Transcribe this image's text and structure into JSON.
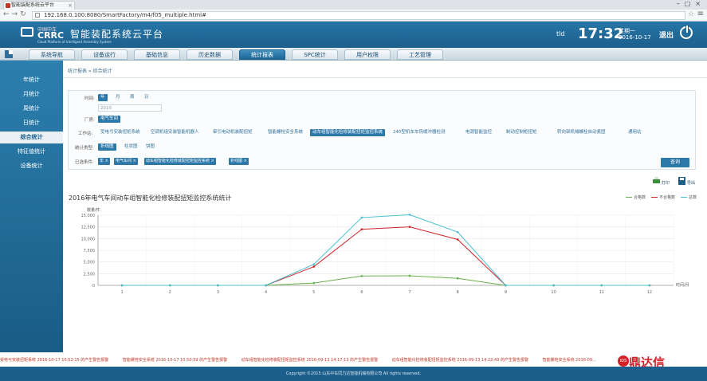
{
  "browser": {
    "tab_title": "智能装配系统云平台",
    "url": "192.168.0.100:8080/SmartFactory/m4/f05_multiple.html#"
  },
  "header": {
    "logo_cn": "中国中车",
    "logo_en": "CRRC",
    "system_title": "智能装配系统云平台",
    "system_sub": "Cloud Platform of Intelligent Assembly System",
    "user": "tld",
    "time": "17:32",
    "weekday": "星期一",
    "date": "2016-10-17",
    "logout": "退出"
  },
  "nav": {
    "items": [
      "系统导航",
      "设备运行",
      "基础信息",
      "历史数据",
      "统计报表",
      "SPC统计",
      "用户权限",
      "工艺管理"
    ],
    "active": "统计报表"
  },
  "sidebar": {
    "items": [
      "年统计",
      "月统计",
      "周统计",
      "日统计",
      "综合统计",
      "特征值统计",
      "设备统计"
    ],
    "active": "综合统计"
  },
  "breadcrumb": "统计报表 » 综合统计",
  "filters": {
    "time_label": "时间:",
    "time_options": [
      "年",
      "月",
      "周",
      "日"
    ],
    "year_value": "2016",
    "factory_label": "厂房:",
    "factory_value": "电气车间",
    "workstation_label": "工作站:",
    "workstations": [
      "受电弓安装扭矩系统",
      "空调机组安装智能机器人",
      "牵引电动机装配扭矩",
      "智能螺栓安全系统",
      "动车组智能化检修装配扭矩监控系统",
      "240型机车车钩缓冲器检测",
      "电源智能监控",
      "制动控制柜扭矩",
      "转向架机械螺栓自动紧固",
      "通用站"
    ],
    "workstation_active": "动车组智能化检修装配扭矩监控系统",
    "stat_label": "统计类型:",
    "stat_types": [
      "折线图",
      "柱状图",
      "饼图"
    ],
    "stat_active": "折线图",
    "selected_label": "已选条件:",
    "selected_tags": [
      "年 ×",
      "电气车间 ×",
      "动车组智能化检修装配扭矩监控系统 ×",
      "折线图 ×"
    ],
    "query_button": "查询"
  },
  "tools": {
    "print": "打印",
    "export": "导出"
  },
  "chart_data": {
    "type": "line",
    "title": "2016年电气车间动车组智能化检修装配扭矩监控系统统计",
    "ylabel": "数量/件",
    "xlabel": "时间/月",
    "ylim": [
      0,
      15000
    ],
    "yticks": [
      0,
      2500,
      5000,
      7500,
      10000,
      12500,
      15000
    ],
    "ytick_labels": [
      "0",
      "2,500",
      "5,000",
      "7,500",
      "10,000",
      "12,500",
      "15,000"
    ],
    "categories": [
      "1",
      "2",
      "3",
      "4",
      "5",
      "6",
      "7",
      "8",
      "9",
      "10",
      "11",
      "12"
    ],
    "legend_position": "top-right",
    "series": [
      {
        "name": "合格数",
        "color": "#6ab04c",
        "values": [
          0,
          0,
          0,
          0,
          500,
          2000,
          2050,
          1500,
          0,
          0,
          0,
          0
        ]
      },
      {
        "name": "不合格数",
        "color": "#d2232a",
        "values": [
          0,
          0,
          0,
          0,
          4000,
          12000,
          12500,
          9800,
          0,
          0,
          0,
          0
        ]
      },
      {
        "name": "总数",
        "color": "#48c0cf",
        "values": [
          0,
          0,
          0,
          0,
          4500,
          14500,
          15100,
          11400,
          0,
          0,
          0,
          0
        ]
      }
    ]
  },
  "ticker": [
    "受电弓安装扭矩系统 2016-10-17 10:52:15 的产生警告报警",
    "智能螺栓安全系统 2016-10-17 10:50:59 的产生警告报警",
    "动车组智能化检修装配扭矩监控系统 2016-09-13 14:17:13 的产生警告报警",
    "动车组智能化检修装配扭矩监控系统 2016-09-13 14:22:43 的产生警告报警",
    "智能螺栓安全系统 2016-09..."
  ],
  "footer": "Copyright ©2015 山东中车同力达智能机械有限公司 All rights reserved.",
  "brand": "鼎达信",
  "brand_badge": "IDS"
}
